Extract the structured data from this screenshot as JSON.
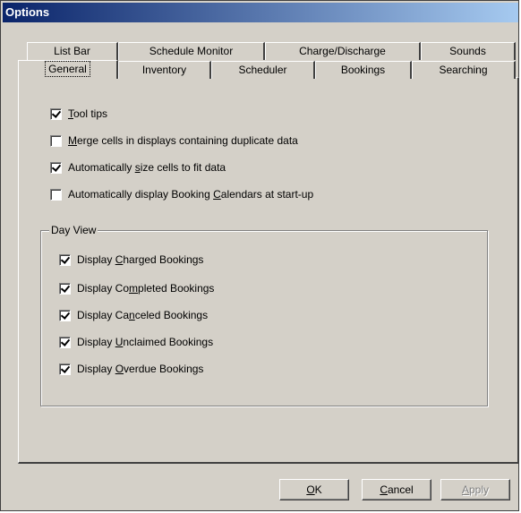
{
  "window": {
    "title": "Options"
  },
  "tabs_back": [
    {
      "label": "List Bar"
    },
    {
      "label": "Schedule Monitor"
    },
    {
      "label": "Charge/Discharge"
    },
    {
      "label": "Sounds"
    }
  ],
  "tabs_front": [
    {
      "label": "General",
      "selected": true
    },
    {
      "label": "Inventory"
    },
    {
      "label": "Scheduler"
    },
    {
      "label": "Bookings"
    },
    {
      "label": "Searching"
    }
  ],
  "general": {
    "tool_tips": {
      "hotkey": "T",
      "rest": "ool tips",
      "checked": true
    },
    "merge_cells": {
      "hotkey": "M",
      "rest": "erge cells in displays containing duplicate data",
      "checked": false
    },
    "auto_size": {
      "before": "Automatically ",
      "hotkey": "s",
      "after": "ize cells to fit data",
      "checked": true
    },
    "auto_calendar": {
      "before": "Automatically display Booking ",
      "hotkey": "C",
      "after": "alendars at start-up",
      "checked": false
    }
  },
  "day_view": {
    "label": "Day View",
    "items": [
      {
        "before": "Display ",
        "hotkey": "C",
        "after": "harged Bookings",
        "checked": true
      },
      {
        "before": "Display Co",
        "hotkey": "m",
        "after": "pleted Bookings",
        "checked": true
      },
      {
        "before": "Display Ca",
        "hotkey": "n",
        "after": "celed Bookings",
        "checked": true
      },
      {
        "before": "Display ",
        "hotkey": "U",
        "after": "nclaimed Bookings",
        "checked": true
      },
      {
        "before": "Display ",
        "hotkey": "O",
        "after": "verdue Bookings",
        "checked": true
      }
    ]
  },
  "buttons": {
    "ok": {
      "hotkey": "O",
      "rest": "K"
    },
    "cancel": {
      "hotkey": "C",
      "rest": "ancel"
    },
    "apply": {
      "hotkey": "A",
      "rest": "pply",
      "disabled": true
    }
  }
}
